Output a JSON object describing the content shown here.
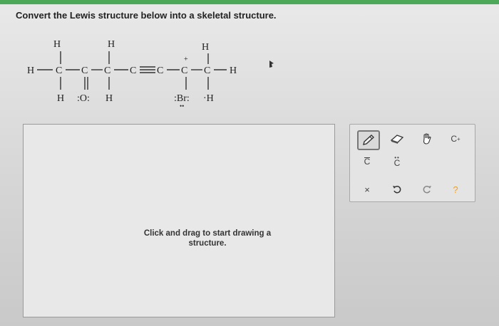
{
  "prompt": "Convert the Lewis structure below into a skeletal structure.",
  "lewis": {
    "atoms": {
      "h_top1": "H",
      "h_top2": "H",
      "h_top3": "H",
      "h_left": "H",
      "c1": "C",
      "c2": "C",
      "c3": "C",
      "c4": "C",
      "c5": "C",
      "c6": "C",
      "c7": "C",
      "h_right": "H",
      "h_bot1": "H",
      "o": ":O:",
      "h_bot2": "H",
      "br": ":Br:",
      "h_bot3": "·H",
      "plus": "+",
      "lone_pair": "••"
    }
  },
  "canvas": {
    "hint": "Click and drag to start drawing a structure."
  },
  "palette": {
    "tools": [
      {
        "name": "pencil-tool",
        "icon": "pencil-icon"
      },
      {
        "name": "eraser-tool",
        "icon": "eraser-icon"
      },
      {
        "name": "hand-tool",
        "icon": "hand-icon"
      },
      {
        "name": "charge-tool",
        "label": "C",
        "sup": "+"
      },
      {
        "name": "radical-tool",
        "label": "C"
      },
      {
        "name": "lone-pair-tool",
        "label": "C"
      },
      {
        "name": "clear-tool",
        "label": "×"
      },
      {
        "name": "undo-tool",
        "icon": "undo-icon"
      },
      {
        "name": "redo-tool",
        "icon": "redo-icon"
      },
      {
        "name": "help-tool",
        "label": "?"
      }
    ],
    "colors": {
      "help": "#e8a030",
      "undo": "#333333"
    }
  }
}
